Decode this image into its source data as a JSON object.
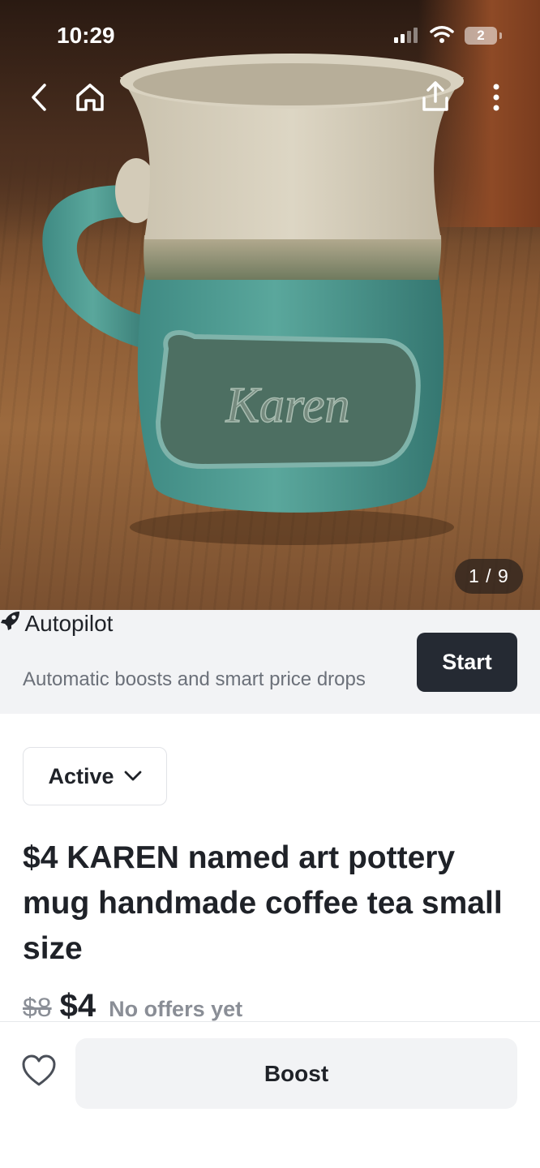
{
  "status_bar": {
    "time": "10:29",
    "battery": "2"
  },
  "gallery": {
    "counter": "1 / 9",
    "mug_text": "Karen"
  },
  "autopilot": {
    "title": "Autopilot",
    "subtitle": "Automatic boosts and smart price drops",
    "start_label": "Start"
  },
  "listing": {
    "status": "Active",
    "title": "$4 KAREN named art pottery mug handmade coffee tea small size",
    "original_price": "$8",
    "price": "$4",
    "offers": "No offers yet"
  },
  "footer": {
    "boost_label": "Boost"
  },
  "colors": {
    "dark_button": "#252a33",
    "banner_bg": "#f2f3f5",
    "muted_text": "#8a8e96"
  }
}
